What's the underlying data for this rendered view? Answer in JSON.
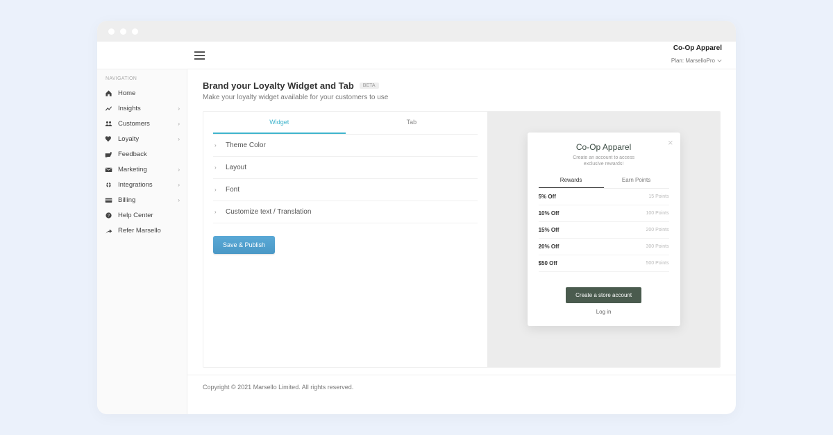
{
  "account": {
    "name": "Co-Op Apparel",
    "plan_label": "Plan: MarselloPro"
  },
  "sidebar": {
    "heading": "NAVIGATION",
    "items": [
      {
        "label": "Home",
        "icon": "home-icon",
        "expandable": false
      },
      {
        "label": "Insights",
        "icon": "insights-icon",
        "expandable": true
      },
      {
        "label": "Customers",
        "icon": "customers-icon",
        "expandable": true
      },
      {
        "label": "Loyalty",
        "icon": "loyalty-icon",
        "expandable": true
      },
      {
        "label": "Feedback",
        "icon": "feedback-icon",
        "expandable": false
      },
      {
        "label": "Marketing",
        "icon": "marketing-icon",
        "expandable": true
      },
      {
        "label": "Integrations",
        "icon": "integrations-icon",
        "expandable": true
      },
      {
        "label": "Billing",
        "icon": "billing-icon",
        "expandable": true
      },
      {
        "label": "Help Center",
        "icon": "help-icon",
        "expandable": false
      },
      {
        "label": "Refer Marsello",
        "icon": "refer-icon",
        "expandable": false
      }
    ]
  },
  "page": {
    "title": "Brand your Loyalty Widget and Tab",
    "badge": "BETA",
    "subtitle": "Make your loyalty widget available for your customers to use"
  },
  "inner_tabs": {
    "widget": "Widget",
    "tab": "Tab",
    "active": "widget"
  },
  "accordion": {
    "items": [
      {
        "label": "Theme Color"
      },
      {
        "label": "Layout"
      },
      {
        "label": "Font"
      },
      {
        "label": "Customize text / Translation"
      }
    ]
  },
  "actions": {
    "save_publish": "Save & Publish"
  },
  "widget_preview": {
    "brand": "Co-Op Apparel",
    "subtitle_line1": "Create an account to access",
    "subtitle_line2": "exclusive rewards!",
    "tabs": {
      "rewards": "Rewards",
      "earn": "Earn Points",
      "active": "rewards"
    },
    "rewards": [
      {
        "label": "5% Off",
        "points": "15 Points"
      },
      {
        "label": "10% Off",
        "points": "100 Points"
      },
      {
        "label": "15% Off",
        "points": "200 Points"
      },
      {
        "label": "20% Off",
        "points": "300 Points"
      },
      {
        "label": "$50 Off",
        "points": "500 Points"
      }
    ],
    "cta": "Create a store account",
    "login": "Log in"
  },
  "footer": {
    "copyright": "Copyright © 2021 Marsello Limited. All rights reserved."
  }
}
